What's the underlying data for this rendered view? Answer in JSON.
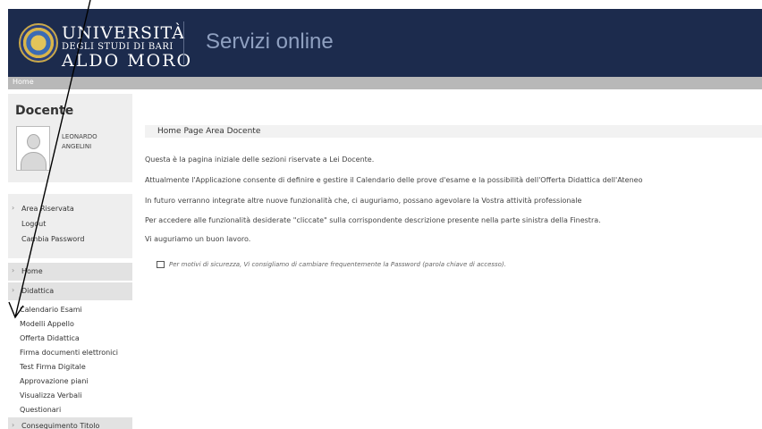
{
  "header": {
    "logo": {
      "line1": "UNIVERSITÀ",
      "line2": "DEGLI STUDI DI BARI",
      "line3": "ALDO MORO"
    },
    "title": "Servizi online"
  },
  "breadcrumb": {
    "home": "Home"
  },
  "sidebar": {
    "docente": {
      "title": "Docente",
      "first_name": "LEONARDO",
      "last_name": "ANGELINI"
    },
    "area_riservata": {
      "label": "Area Riservata",
      "logout": "Logout",
      "cambia_password": "Cambia Password"
    },
    "home_label": "Home",
    "didattica": {
      "label": "Didattica",
      "items": [
        "Calendario Esami",
        "Modelli Appello",
        "Offerta Didattica",
        "Firma documenti elettronici",
        "Test Firma Digitale",
        "Approvazione piani",
        "Visualizza Verbali",
        "Questionari"
      ]
    },
    "conseguimento_titolo": "Conseguimento Titolo"
  },
  "main": {
    "title": "Home Page Area Docente",
    "paragraphs": [
      "Questa è la pagina iniziale delle sezioni riservate a Lei Docente.",
      "Attualmente l'Applicazione consente di definire e gestire il Calendario delle prove d'esame e la possibilità dell'Offerta Didattica dell'Ateneo",
      "In futuro verranno integrate altre nuove funzionalità che, ci auguriamo, possano agevolare la Vostra attività professionale",
      "Per accedere alle funzionalità desiderate \"cliccate\" sulla corrispondente descrizione presente nella parte sinistra della Finestra.",
      "Vi auguriamo un buon lavoro."
    ],
    "note": "Per motivi di sicurezza, Vi consigliamo di cambiare frequentemente la Password (parola chiave di accesso)."
  },
  "colors": {
    "header_bg": "#1c2b4d",
    "header_title": "#8fa0c0",
    "sidebar_bg": "#eeeeee",
    "section_bg": "#e2e2e2"
  }
}
